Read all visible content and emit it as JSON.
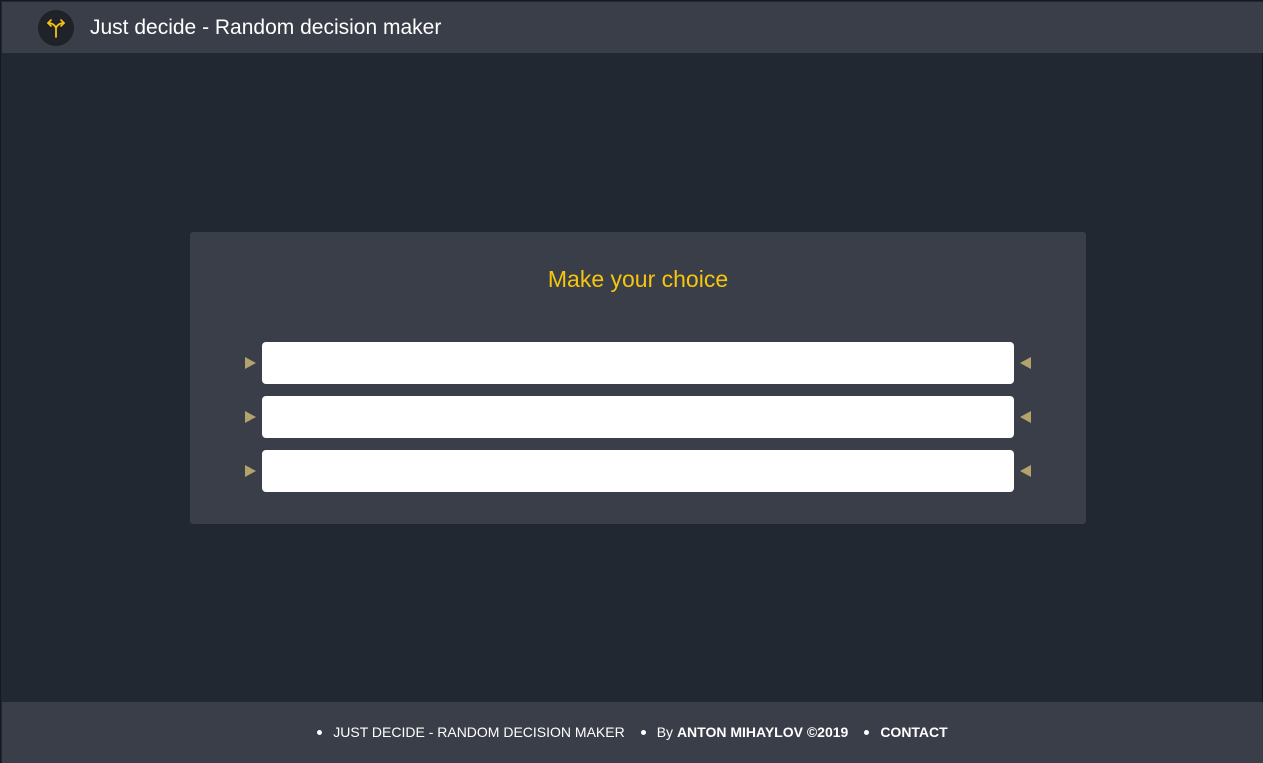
{
  "header": {
    "title": "Just decide - Random decision maker",
    "logo_icon": "fork-arrows-icon",
    "accent_color": "#f6c50e"
  },
  "main": {
    "heading": "Make your choice",
    "choices": [
      {
        "value": "",
        "placeholder": ""
      },
      {
        "value": "",
        "placeholder": ""
      },
      {
        "value": "",
        "placeholder": ""
      }
    ]
  },
  "footer": {
    "app_name": "JUST DECIDE - RANDOM DECISION MAKER",
    "by_prefix": "By",
    "author": "ANTON MIHAYLOV ©2019",
    "contact_label": "CONTACT"
  }
}
